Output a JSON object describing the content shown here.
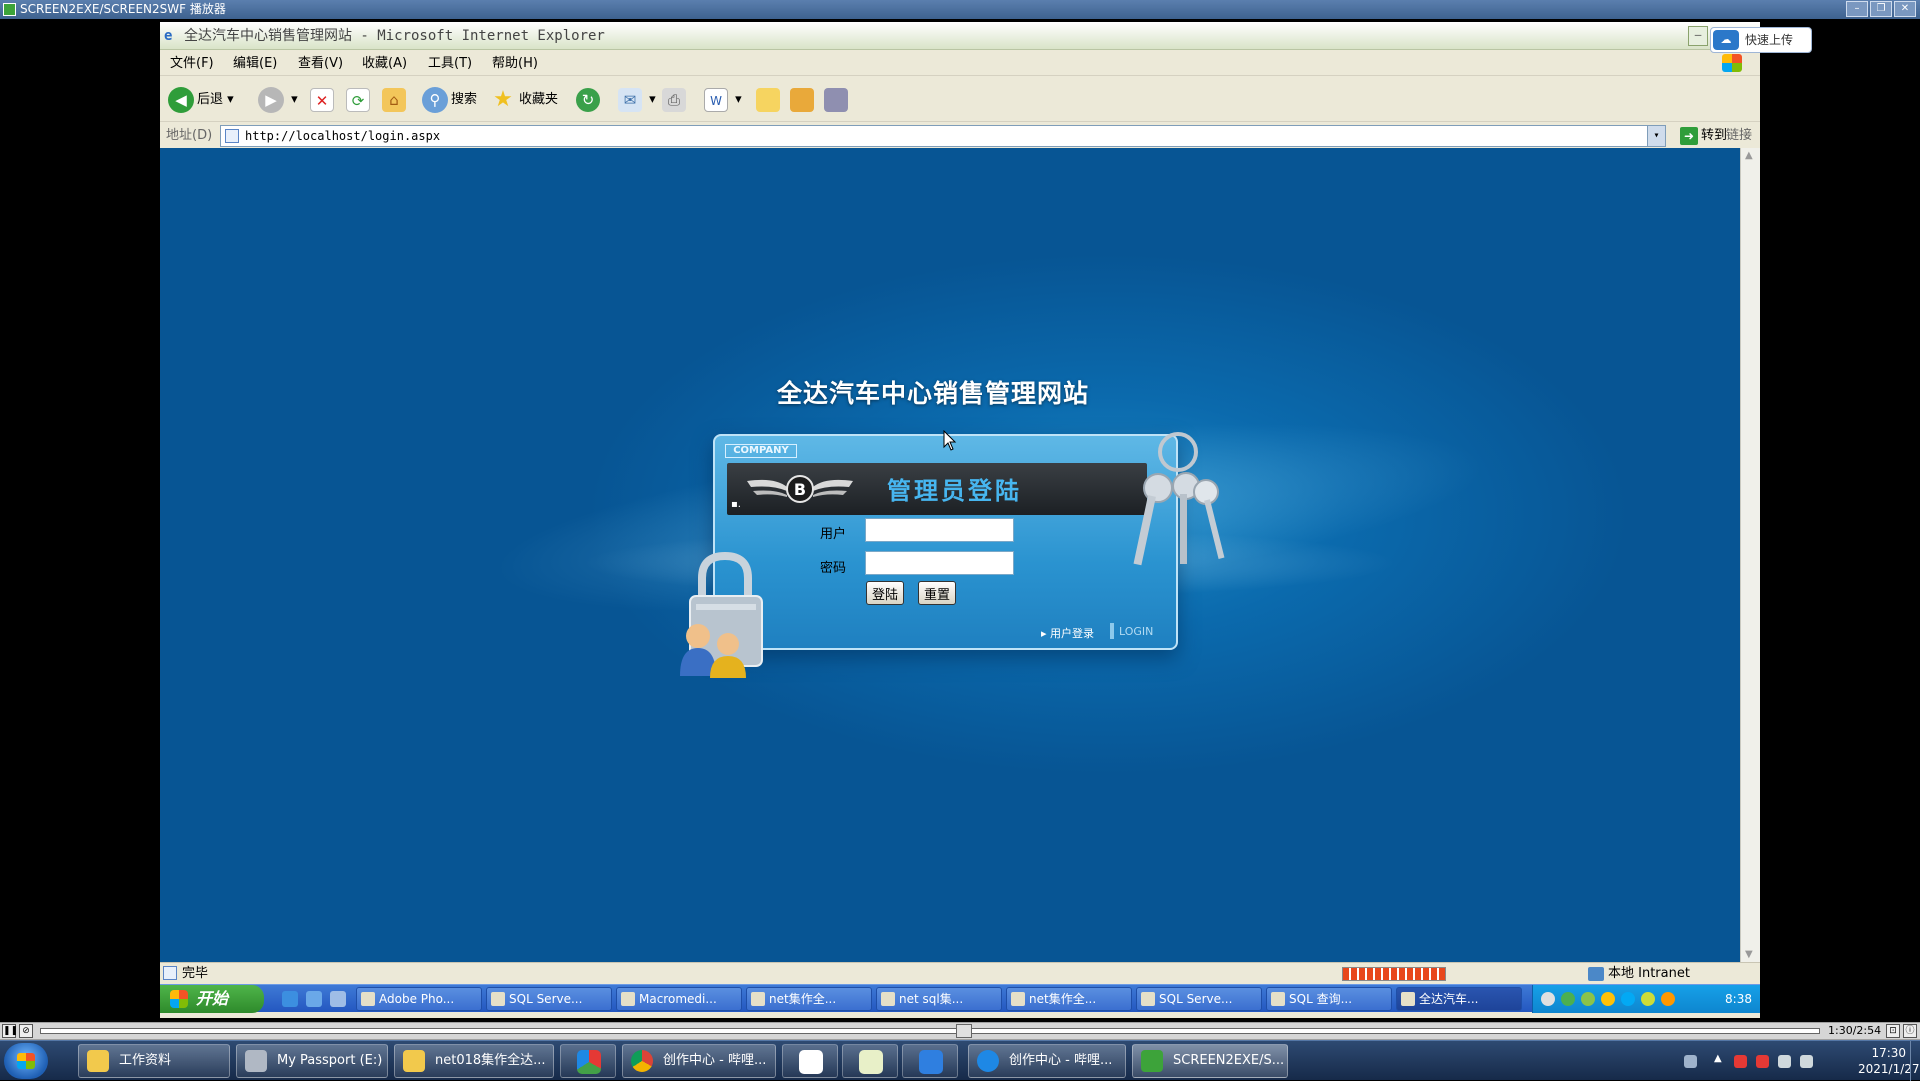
{
  "player": {
    "title": "SCREEN2EXE/SCREEN2SWF 播放器",
    "time": "1:30/2:54"
  },
  "ie": {
    "title": "全达汽车中心销售管理网站 - Microsoft Internet Explorer",
    "upload_label": "快速上传",
    "menu": [
      "文件(F)",
      "编辑(E)",
      "查看(V)",
      "收藏(A)",
      "工具(T)",
      "帮助(H)"
    ],
    "toolbar": {
      "back": "后退",
      "search": "搜索",
      "favorites": "收藏夹"
    },
    "address": {
      "label": "地址(D)",
      "url": "http://localhost/login.aspx",
      "go": "转到",
      "links": "链接"
    },
    "status": {
      "done": "完毕",
      "zone": "本地 Intranet"
    }
  },
  "page": {
    "site_title": "全达汽车中心销售管理网站",
    "panel": {
      "company": "COMPANY",
      "heading": "管理员登陆",
      "user_label": "用户",
      "password_label": "密码",
      "user_value": "",
      "password_value": "",
      "login_button": "登陆",
      "reset_button": "重置",
      "footer_user_login": "▸ 用户登录",
      "footer_login": "LOGIN"
    }
  },
  "xp_taskbar": {
    "start": "开始",
    "tasks": [
      "Adobe Pho...",
      "SQL Serve...",
      "Macromedi...",
      "net集作全...",
      "net sql集...",
      "net集作全...",
      "SQL Serve...",
      "SQL 查询...",
      "全达汽车..."
    ],
    "clock": "8:38"
  },
  "win7_taskbar": {
    "tasks": {
      "work": "工作资料",
      "passport": "My Passport (E:)",
      "folder": "net018集作全达...",
      "chrome": "创作中心 - 哔哩...",
      "edge": "创作中心 - 哔哩...",
      "screen2exe": "SCREEN2EXE/S..."
    },
    "time": "17:30",
    "date": "2021/1/27"
  },
  "colors": {
    "page_blue": "#0b6aad",
    "banner_title": "#47b6f0",
    "xp_blue": "#2457c0"
  }
}
